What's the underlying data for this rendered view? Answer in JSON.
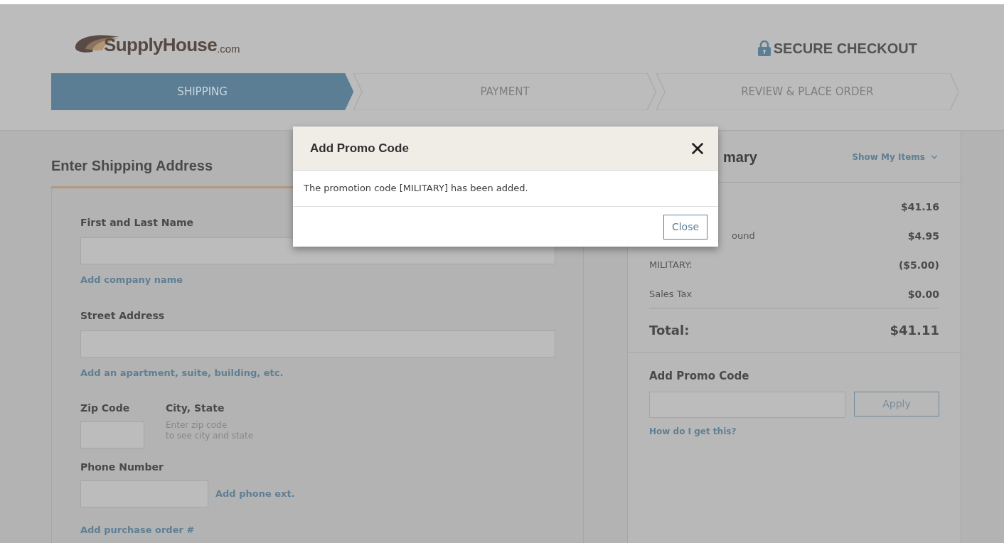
{
  "header": {
    "logo": {
      "name": "SupplyHouse",
      "suffix": ".com"
    },
    "secure": "SECURE CHECKOUT"
  },
  "steps": [
    {
      "label": "SHIPPING",
      "selected": true
    },
    {
      "label": "PAYMENT",
      "selected": false
    },
    {
      "label": "REVIEW & PLACE ORDER",
      "selected": false
    }
  ],
  "shipping": {
    "title": "Enter Shipping Address",
    "name_label": "First and Last Name",
    "company_link": "Add company name",
    "street_label": "Street Address",
    "apartment_link": "Add an apartment, suite, building, etc.",
    "zip_label": "Zip Code",
    "city_label": "City, State",
    "city_hint": [
      "Enter zip code",
      "to see city and state"
    ],
    "phone_label": "Phone Number",
    "phone_ext_link": "Add phone ext.",
    "po_link": "Add purchase order #"
  },
  "summary": {
    "title_visible": "mary",
    "show_items": "Show My Items",
    "rows": [
      {
        "value": "$41.16"
      },
      {
        "label": "ound",
        "value": "$4.95"
      },
      {
        "label": "MILITARY:",
        "value": "($5.00)"
      },
      {
        "label": "Sales Tax",
        "value": "$0.00"
      }
    ],
    "total_label": "Total:",
    "total_value": "$41.11",
    "promo_title": "Add Promo Code",
    "apply": "Apply",
    "help_link": "How do I get this?"
  },
  "modal": {
    "title": "Add Promo Code",
    "message": "The promotion code [MILITARY] has been added.",
    "close": "Close"
  }
}
